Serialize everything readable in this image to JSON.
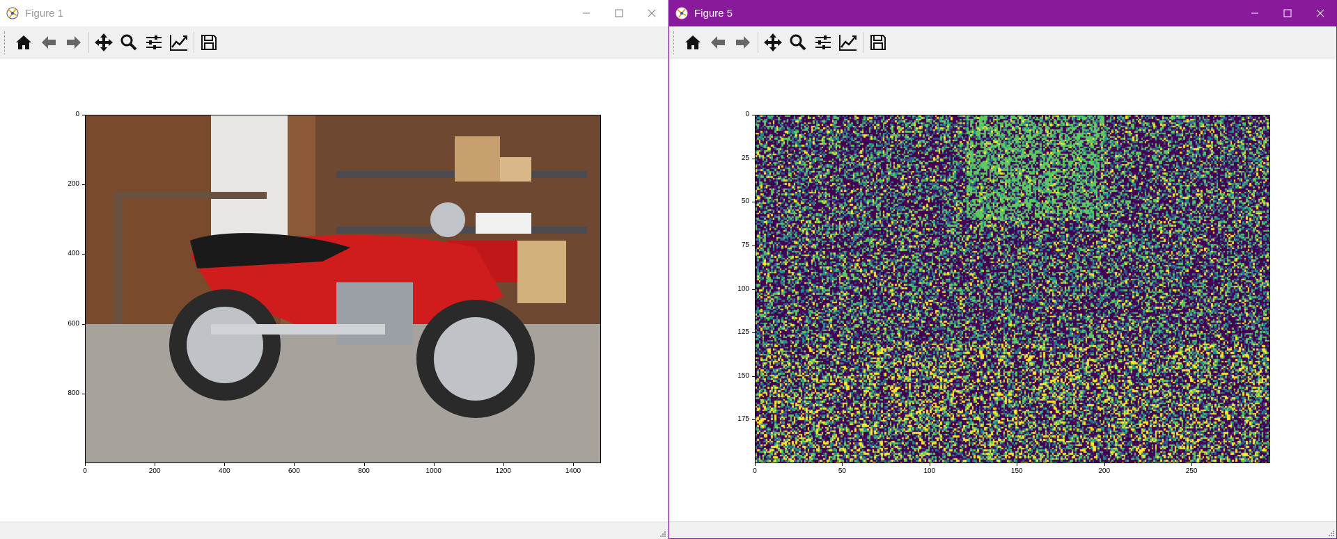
{
  "accent": "#8a1a9c",
  "window1": {
    "title": "Figure 1",
    "toolbar": [
      "home-icon",
      "back-arrow-icon",
      "forward-arrow-icon",
      "pan-icon",
      "zoom-icon",
      "configure-subplots-icon",
      "edit-axis-icon",
      "save-icon"
    ],
    "image_description_subject": "red motorcycle in garage",
    "yticks": [
      "0",
      "200",
      "400",
      "600",
      "800"
    ],
    "xticks": [
      "0",
      "200",
      "400",
      "600",
      "800",
      "1000",
      "1200",
      "1400"
    ]
  },
  "window2": {
    "title": "Figure 5",
    "toolbar": [
      "home-icon",
      "back-arrow-icon",
      "forward-arrow-icon",
      "pan-icon",
      "zoom-icon",
      "configure-subplots-icon",
      "edit-axis-icon",
      "save-icon"
    ],
    "yticks": [
      "0",
      "25",
      "50",
      "75",
      "100",
      "125",
      "150",
      "175"
    ],
    "xticks": [
      "0",
      "50",
      "100",
      "150",
      "200",
      "250"
    ],
    "heatmap_colors": [
      "#440154",
      "#3b528b",
      "#21918c",
      "#5ec962",
      "#fde725"
    ]
  }
}
